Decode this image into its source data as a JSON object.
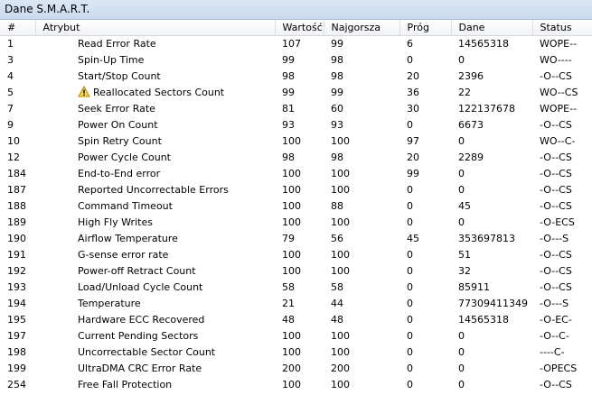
{
  "window": {
    "title": "Dane S.M.A.R.T."
  },
  "columns": [
    "#",
    "Atrybut",
    "Wartość",
    "Najgorsza",
    "Próg",
    "Dane",
    "Status"
  ],
  "rows": [
    {
      "id": "1",
      "name": "Read Error Rate",
      "value": "107",
      "worst": "99",
      "thresh": "6",
      "data": "14565318",
      "status": "WOPE--"
    },
    {
      "id": "3",
      "name": "Spin-Up Time",
      "value": "99",
      "worst": "98",
      "thresh": "0",
      "data": "0",
      "status": "WO----"
    },
    {
      "id": "4",
      "name": "Start/Stop Count",
      "value": "98",
      "worst": "98",
      "thresh": "20",
      "data": "2396",
      "status": "-O--CS"
    },
    {
      "id": "5",
      "name": "Reallocated Sectors Count",
      "value": "99",
      "worst": "99",
      "thresh": "36",
      "data": "22",
      "status": "WO--CS",
      "warning": true
    },
    {
      "id": "7",
      "name": "Seek Error Rate",
      "value": "81",
      "worst": "60",
      "thresh": "30",
      "data": "122137678",
      "status": "WOPE--"
    },
    {
      "id": "9",
      "name": "Power On Count",
      "value": "93",
      "worst": "93",
      "thresh": "0",
      "data": "6673",
      "status": "-O--CS"
    },
    {
      "id": "10",
      "name": "Spin Retry Count",
      "value": "100",
      "worst": "100",
      "thresh": "97",
      "data": "0",
      "status": "WO--C-"
    },
    {
      "id": "12",
      "name": "Power Cycle Count",
      "value": "98",
      "worst": "98",
      "thresh": "20",
      "data": "2289",
      "status": "-O--CS"
    },
    {
      "id": "184",
      "name": "End-to-End error",
      "value": "100",
      "worst": "100",
      "thresh": "99",
      "data": "0",
      "status": "-O--CS"
    },
    {
      "id": "187",
      "name": "Reported Uncorrectable Errors",
      "value": "100",
      "worst": "100",
      "thresh": "0",
      "data": "0",
      "status": "-O--CS"
    },
    {
      "id": "188",
      "name": "Command Timeout",
      "value": "100",
      "worst": "88",
      "thresh": "0",
      "data": "45",
      "status": "-O--CS"
    },
    {
      "id": "189",
      "name": "High Fly Writes",
      "value": "100",
      "worst": "100",
      "thresh": "0",
      "data": "0",
      "status": "-O-ECS"
    },
    {
      "id": "190",
      "name": "Airflow Temperature",
      "value": "79",
      "worst": "56",
      "thresh": "45",
      "data": "353697813",
      "status": "-O---S"
    },
    {
      "id": "191",
      "name": "G-sense error rate",
      "value": "100",
      "worst": "100",
      "thresh": "0",
      "data": "51",
      "status": "-O--CS"
    },
    {
      "id": "192",
      "name": "Power-off Retract Count",
      "value": "100",
      "worst": "100",
      "thresh": "0",
      "data": "32",
      "status": "-O--CS"
    },
    {
      "id": "193",
      "name": "Load/Unload Cycle Count",
      "value": "58",
      "worst": "58",
      "thresh": "0",
      "data": "85911",
      "status": "-O--CS"
    },
    {
      "id": "194",
      "name": "Temperature",
      "value": "21",
      "worst": "44",
      "thresh": "0",
      "data": "77309411349",
      "status": "-O---S"
    },
    {
      "id": "195",
      "name": "Hardware ECC Recovered",
      "value": "48",
      "worst": "48",
      "thresh": "0",
      "data": "14565318",
      "status": "-O-EC-"
    },
    {
      "id": "197",
      "name": "Current Pending Sectors",
      "value": "100",
      "worst": "100",
      "thresh": "0",
      "data": "0",
      "status": "-O--C-"
    },
    {
      "id": "198",
      "name": "Uncorrectable Sector Count",
      "value": "100",
      "worst": "100",
      "thresh": "0",
      "data": "0",
      "status": "----C-"
    },
    {
      "id": "199",
      "name": "UltraDMA CRC Error Rate",
      "value": "200",
      "worst": "200",
      "thresh": "0",
      "data": "0",
      "status": "-OPECS"
    },
    {
      "id": "254",
      "name": "Free Fall Protection",
      "value": "100",
      "worst": "100",
      "thresh": "0",
      "data": "0",
      "status": "-O--CS"
    }
  ],
  "icons": {
    "warning": "warning-triangle-icon"
  },
  "colors": {
    "warning_fill": "#f7d44a",
    "warning_stroke": "#b88a00"
  }
}
